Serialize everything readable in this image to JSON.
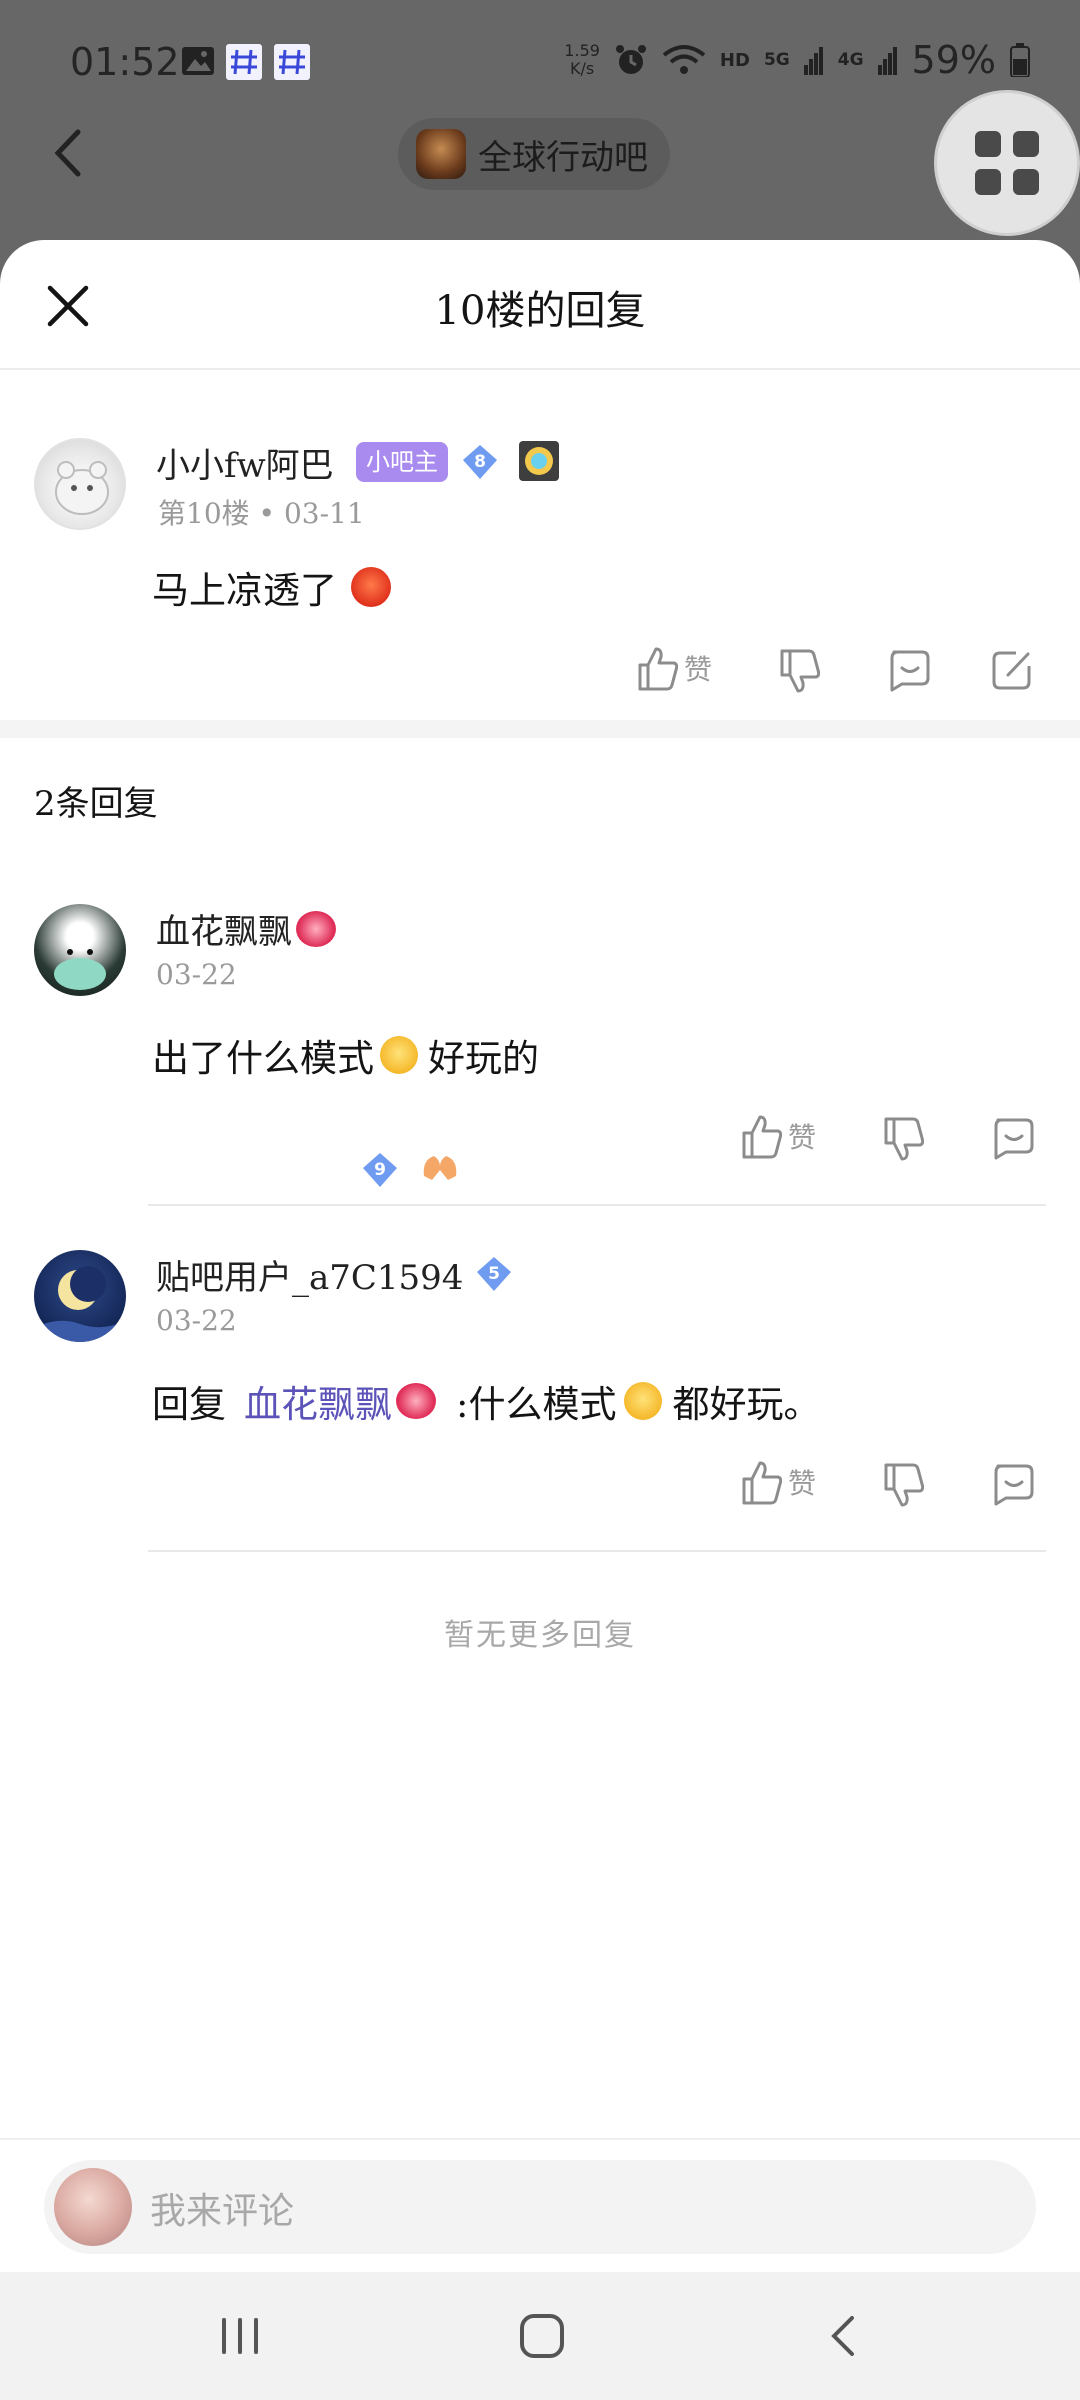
{
  "status_bar": {
    "time": "01:52",
    "net_speed_value": "1.59",
    "net_speed_unit": "K/s",
    "signal_hd": "HD",
    "signal_5g": "5G",
    "signal_4g": "4G",
    "battery": "59%"
  },
  "background": {
    "forum_name": "全球行动吧"
  },
  "sheet": {
    "title": "10楼的回复"
  },
  "main_post": {
    "username": "小小fw阿巴",
    "role_badge": "小吧主",
    "level": "8",
    "floor_date": "第10楼 • 03-11",
    "content": "马上凉透了",
    "like_label": "赞"
  },
  "replies_header": "2条回复",
  "replies": [
    {
      "username": "血花飘飘",
      "level": "9",
      "date": "03-22",
      "content_a": "出了什么模式",
      "content_b": "好玩的",
      "like_label": "赞"
    },
    {
      "username": "贴吧用户_a7C1594",
      "level": "5",
      "date": "03-22",
      "reply_prefix": "回复",
      "mention": "血花飘飘",
      "content_a": ":什么模式",
      "content_b": "都好玩。",
      "like_label": "赞"
    }
  ],
  "no_more_text": "暂无更多回复",
  "comment_bar": {
    "placeholder": "我来评论"
  },
  "colors": {
    "role_badge": "#a98bf0",
    "level_diamond": "#6f9bf0",
    "mention": "#5b53b8",
    "meta_gray": "#9a9a9a"
  }
}
